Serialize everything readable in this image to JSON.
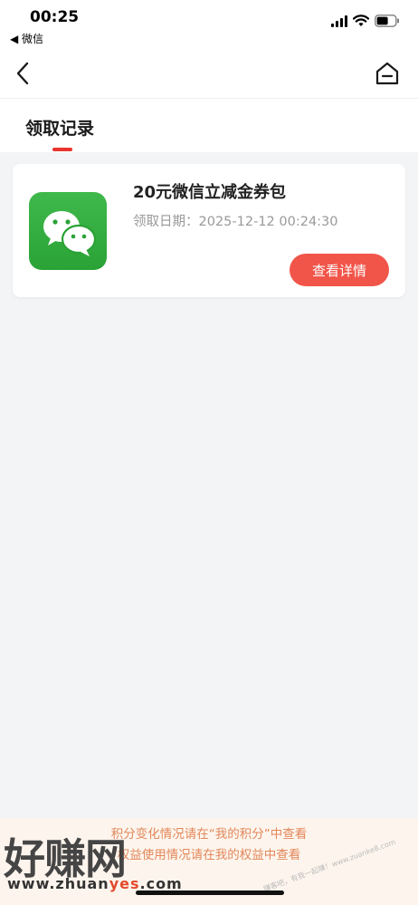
{
  "status_bar": {
    "time": "00:25",
    "back_app": "◀ 微信"
  },
  "nav": {
    "back_icon": "chevron-left-icon",
    "home_icon": "home-icon"
  },
  "tab": {
    "title": "领取记录",
    "accent_color": "#e8352e"
  },
  "record": {
    "logo_icon": "wechat-logo-icon",
    "title": "20元微信立减金券包",
    "date_label": "领取日期：",
    "date_value": "2025-12-12 00:24:30",
    "detail_button": "查看详情",
    "button_color": "#f15549"
  },
  "footer": {
    "line1": "积分变化情况请在“我的积分”中查看",
    "line2": "权益使用情况请在我的权益中查看"
  },
  "watermark": {
    "brand": "好赚网",
    "url_prefix": "www.zhuan",
    "url_accent": "yes",
    "url_suffix": ".com",
    "right_text": "赚客吧，有我一起赚！www.zuanke8.com"
  }
}
